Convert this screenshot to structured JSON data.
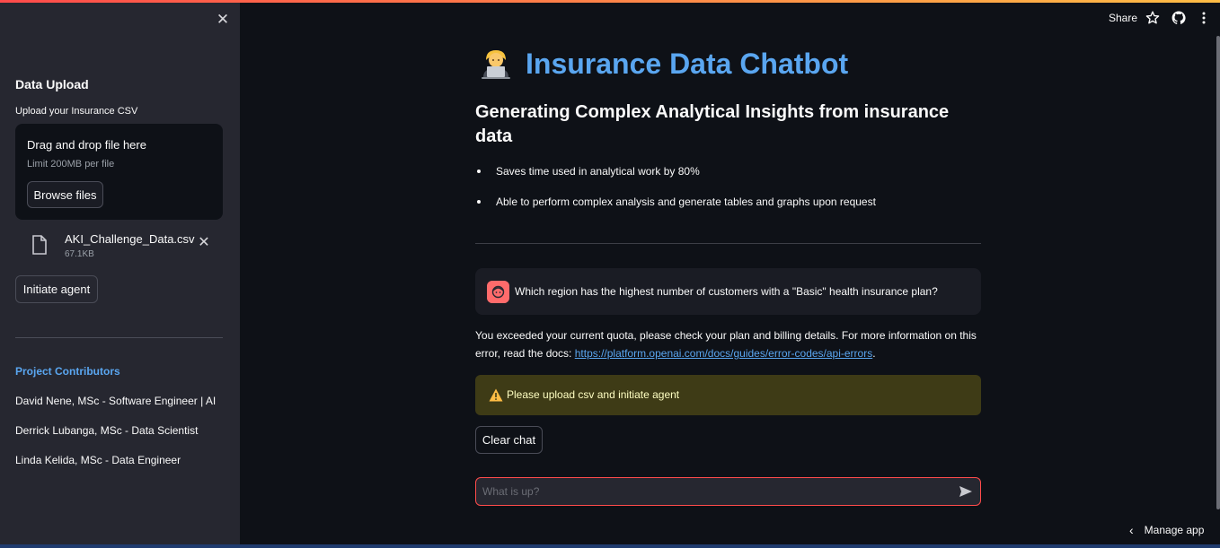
{
  "sidebar": {
    "close_glyph": "✕",
    "heading": "Data Upload",
    "upload_label": "Upload your Insurance CSV",
    "dropzone": {
      "title": "Drag and drop file here",
      "limit": "Limit 200MB per file",
      "browse_label": "Browse files"
    },
    "file": {
      "name": "AKI_Challenge_Data.csv",
      "size": "67.1KB",
      "icon": "file-icon",
      "remove_glyph": "✕"
    },
    "initiate_label": "Initiate agent",
    "contributors_heading": "Project Contributors",
    "contributors": [
      "David Nene, MSc - Software Engineer | AI",
      "Derrick Lubanga, MSc - Data Scientist",
      "Linda Kelida, MSc - Data Engineer"
    ]
  },
  "header": {
    "share_label": "Share",
    "icons": [
      "star-icon",
      "github-icon",
      "more-vertical-icon"
    ]
  },
  "main": {
    "title": "Insurance Data Chatbot",
    "title_emoji": "technologist-emoji",
    "subtitle": "Generating Complex Analytical Insights from insurance data",
    "bullets": [
      "Saves time used in analytical work by 80%",
      "Able to perform complex analysis and generate tables and graphs upon request"
    ],
    "chat": {
      "user_message": "Which region has the highest number of customers with a \"Basic\" health insurance plan?",
      "error_text": "You exceeded your current quota, please check your plan and billing details. For more information on this error, read the docs: ",
      "error_link": "https://platform.openai.com/docs/guides/error-codes/api-errors",
      "error_suffix": "."
    },
    "warning": "Please upload csv and initiate agent",
    "clear_label": "Clear chat",
    "input_placeholder": "What is up?"
  },
  "footer": {
    "manage_label": "Manage app"
  },
  "colors": {
    "accent": "#ff4b4b",
    "title_blue": "#5aa6f0",
    "background": "#0e1117",
    "sidebar": "#262730",
    "warning_bg": "#3e3b16",
    "warning_text": "#ffffc2"
  }
}
